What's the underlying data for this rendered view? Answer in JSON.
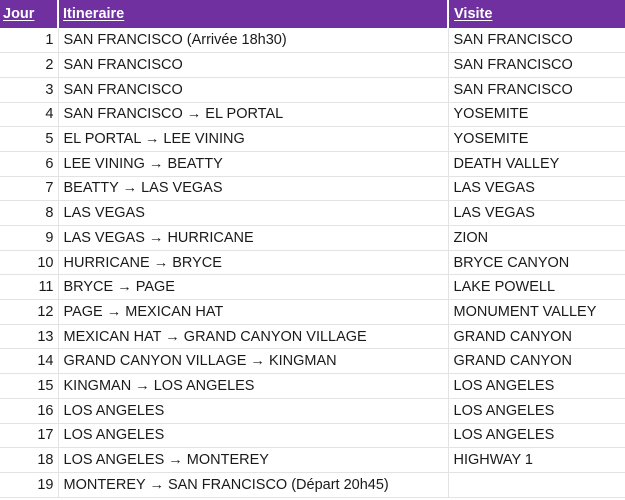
{
  "theme": {
    "header_bg": "#7030A0",
    "header_text": "#FFFFFF",
    "grid_line": "#E3E3E3",
    "body_text": "#1A1A1A",
    "sheet_bg": "#FFFFFF"
  },
  "table": {
    "columns": [
      {
        "key": "jour",
        "label": "Jour",
        "align": "right"
      },
      {
        "key": "itineraire",
        "label": "Itineraire",
        "align": "left"
      },
      {
        "key": "visite",
        "label": "Visite",
        "align": "left"
      }
    ],
    "rows": [
      {
        "jour": "1",
        "itineraire": "SAN FRANCISCO (Arrivée 18h30)",
        "visite": "SAN FRANCISCO"
      },
      {
        "jour": "2",
        "itineraire": "SAN FRANCISCO",
        "visite": "SAN FRANCISCO"
      },
      {
        "jour": "3",
        "itineraire": "SAN FRANCISCO",
        "visite": "SAN FRANCISCO"
      },
      {
        "jour": "4",
        "itineraire": "SAN FRANCISCO → EL PORTAL",
        "visite": "YOSEMITE"
      },
      {
        "jour": "5",
        "itineraire": "EL PORTAL → LEE VINING",
        "visite": "YOSEMITE"
      },
      {
        "jour": "6",
        "itineraire": "LEE VINING → BEATTY",
        "visite": "DEATH VALLEY"
      },
      {
        "jour": "7",
        "itineraire": "BEATTY → LAS VEGAS",
        "visite": "LAS VEGAS"
      },
      {
        "jour": "8",
        "itineraire": "LAS VEGAS",
        "visite": "LAS VEGAS"
      },
      {
        "jour": "9",
        "itineraire": "LAS VEGAS → HURRICANE",
        "visite": "ZION"
      },
      {
        "jour": "10",
        "itineraire": "HURRICANE → BRYCE",
        "visite": "BRYCE CANYON"
      },
      {
        "jour": "11",
        "itineraire": "BRYCE → PAGE",
        "visite": "LAKE POWELL"
      },
      {
        "jour": "12",
        "itineraire": "PAGE → MEXICAN HAT",
        "visite": "MONUMENT VALLEY"
      },
      {
        "jour": "13",
        "itineraire": "MEXICAN HAT → GRAND CANYON VILLAGE",
        "visite": "GRAND CANYON"
      },
      {
        "jour": "14",
        "itineraire": "GRAND CANYON VILLAGE → KINGMAN",
        "visite": "GRAND CANYON"
      },
      {
        "jour": "15",
        "itineraire": "KINGMAN → LOS ANGELES",
        "visite": "LOS ANGELES"
      },
      {
        "jour": "16",
        "itineraire": "LOS ANGELES",
        "visite": "LOS ANGELES"
      },
      {
        "jour": "17",
        "itineraire": "LOS ANGELES",
        "visite": "LOS ANGELES"
      },
      {
        "jour": "18",
        "itineraire": "LOS ANGELES → MONTEREY",
        "visite": "HIGHWAY 1"
      },
      {
        "jour": "19",
        "itineraire": "MONTEREY → SAN FRANCISCO (Départ 20h45)",
        "visite": ""
      }
    ]
  }
}
